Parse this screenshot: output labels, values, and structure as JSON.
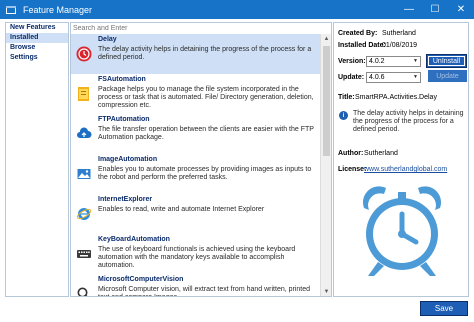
{
  "window": {
    "title": "Feature Manager",
    "minimize_glyph": "—",
    "maximize_glyph": "☐",
    "close_glyph": "✕"
  },
  "sidebar": {
    "items": [
      {
        "label": "New Features",
        "selected": false
      },
      {
        "label": "Installed",
        "selected": true
      },
      {
        "label": "Browse",
        "selected": false
      },
      {
        "label": "Settings",
        "selected": false
      }
    ]
  },
  "search": {
    "value": "",
    "placeholder": "Search and Enter"
  },
  "features": [
    {
      "name": "Delay",
      "description": "The delay activity helps in detaining the progress of the process for a defined period.",
      "icon": "delay-icon",
      "selected": true
    },
    {
      "name": "FSAutomation",
      "description": "Package helps you to manage the file system incorporated in the process or task that is automated. File/ Directory generation, deletion, compression etc.",
      "icon": "folder-icon",
      "selected": false
    },
    {
      "name": "FTPAutomation",
      "description": "The file transfer operation between the clients are easier with the FTP Automation package.",
      "icon": "cloud-upload-icon",
      "selected": false
    },
    {
      "name": "ImageAutomation",
      "description": "Enables you to automate processes by providing images as inputs to the robot and perform the preferred tasks.",
      "icon": "image-icon",
      "selected": false
    },
    {
      "name": "InternetExplorer",
      "description": "Enables to read, write and automate Internet Explorer",
      "icon": "internet-explorer-icon",
      "selected": false
    },
    {
      "name": "KeyBoardAutomation",
      "description": "The use of keyboard functionals is achieved using the keyboard automation with the mandatory keys available to accomplish automation.",
      "icon": "keyboard-icon",
      "selected": false
    },
    {
      "name": "MicrosoftComputerVision",
      "description": "Microsoft Computer vision, will extract text from hand written, printed text and compare Images.",
      "icon": "magnifier-icon",
      "selected": false
    }
  ],
  "details": {
    "created_by_label": "Created By:",
    "created_by": "Sutherland",
    "installed_date_label": "Installed Date:",
    "installed_date": "01/08/2019",
    "version_label": "Version:",
    "version": "4.0.2",
    "update_label": "Update:",
    "update_version": "4.0.6",
    "uninstall_label": "UnInstall",
    "update_button_label": "Update",
    "title_label": "Title:",
    "title": "SmartRPA.Activities.Delay",
    "description": "The delay activity helps in detaining the progress of the process for a defined period.",
    "author_label": "Author:",
    "author": "Sutherland",
    "license_label": "License:",
    "license": "www.sutherlandglobal.com",
    "image_icon": "alarm-clock-icon"
  },
  "footer": {
    "save_label": "Save"
  },
  "colors": {
    "accent": "#1e5fb5",
    "titlebar": "#1773c7",
    "selection": "#cfe0f6",
    "clock": "#4d9bd6"
  }
}
